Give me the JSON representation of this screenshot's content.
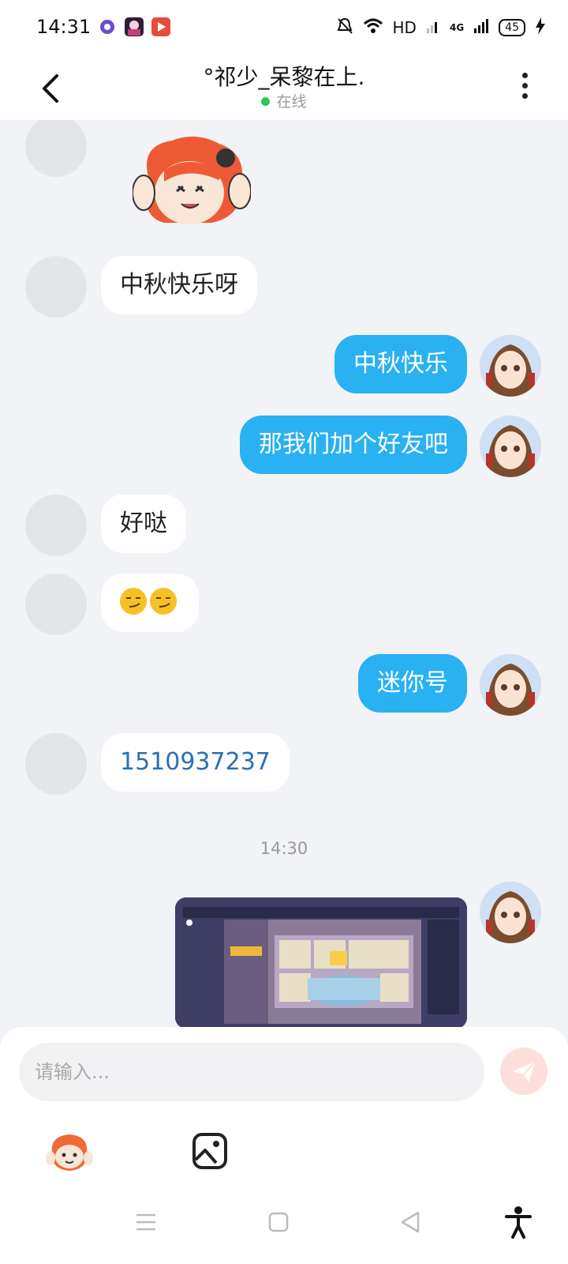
{
  "status_bar": {
    "time": "14:31",
    "network": "HD",
    "signal": "4G",
    "battery": "45"
  },
  "header": {
    "title": "°祁少_呆黎在上.",
    "status": "在线"
  },
  "messages": [
    {
      "side": "in",
      "type": "sticker"
    },
    {
      "side": "in",
      "type": "text",
      "text": "中秋快乐呀"
    },
    {
      "side": "out",
      "type": "text",
      "text": "中秋快乐"
    },
    {
      "side": "out",
      "type": "text",
      "text": "那我们加个好友吧"
    },
    {
      "side": "in",
      "type": "text",
      "text": "好哒"
    },
    {
      "side": "in",
      "type": "emoji",
      "emoji": "smirk-face x2"
    },
    {
      "side": "out",
      "type": "text",
      "text": "迷你号"
    },
    {
      "side": "in",
      "type": "text",
      "text": "1510937237"
    },
    {
      "side": "out",
      "type": "image",
      "timestamp": "14:30"
    }
  ],
  "input": {
    "placeholder": "请输入..."
  },
  "colors": {
    "outgoing_bubble": "#29b1f2",
    "incoming_bubble": "#ffffff",
    "background": "#f2f3f7",
    "link": "#2a6fb5",
    "send_button": "#fde0dc"
  }
}
